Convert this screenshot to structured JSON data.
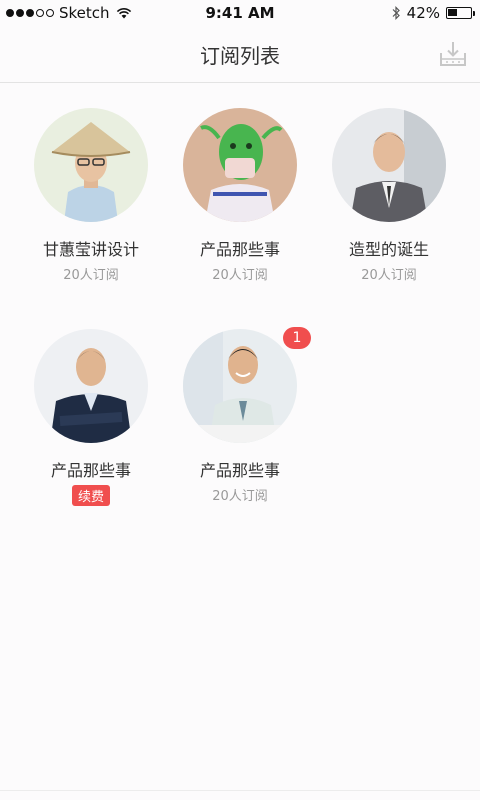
{
  "status_bar": {
    "carrier": "Sketch",
    "time": "9:41 AM",
    "battery": "42%",
    "battery_level": 0.42
  },
  "nav": {
    "title": "订阅列表",
    "download_icon": "download-tray-icon"
  },
  "subscriptions": [
    {
      "name": "甘蕙莹讲设计",
      "subtitle": "20人订阅",
      "avatar": "man-with-conical-hat"
    },
    {
      "name": "产品那些事",
      "subtitle": "20人订阅",
      "avatar": "green-alien-costume"
    },
    {
      "name": "造型的诞生",
      "subtitle": "20人订阅",
      "avatar": "man-in-suit"
    },
    {
      "name": "产品那些事",
      "renew_label": "续费",
      "avatar": "businessman-arms-crossed"
    },
    {
      "name": "产品那些事",
      "subtitle": "20人订阅",
      "badge": "1",
      "avatar": "smiling-man-at-desk"
    }
  ],
  "colors": {
    "accent": "#f04e4e",
    "text": "#333333",
    "muted": "#999999"
  }
}
